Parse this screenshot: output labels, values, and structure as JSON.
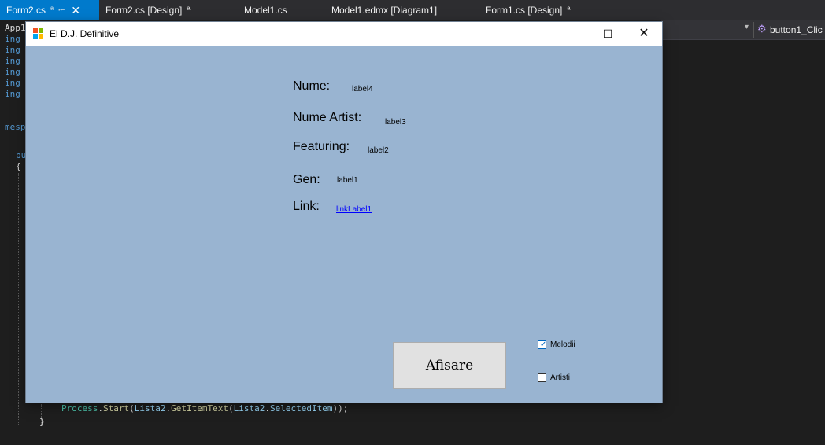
{
  "ide": {
    "tabs": [
      {
        "label": "Form2.cs",
        "pin": "฿",
        "lock": "ª",
        "active": true
      },
      {
        "label": "Form2.cs [Design]",
        "suffix": "ª"
      },
      {
        "label": "Model1.cs"
      },
      {
        "label": "Model1.edmx [Diagram1]"
      },
      {
        "label": "Form1.cs [Design]",
        "suffix": "ª"
      }
    ],
    "tab_glyphs": {
      "lock": "ª",
      "pin": "⭰",
      "close": "✕"
    },
    "nav": {
      "method_label": "button1_Clic"
    },
    "gutter_lines": [
      "App1",
      "ing",
      "ing",
      "ing",
      "ing",
      "ing",
      "ing",
      "",
      "mesp",
      "",
      "pu",
      "{"
    ],
    "code_line": {
      "a": "Process",
      "b": ".",
      "c": "Start",
      "d": "(",
      "e": "Lista2",
      "f": ".",
      "g": "GetItemText",
      "h": "(",
      "i": "Lista2",
      "j": ".",
      "k": "SelectedItem",
      "l": "));"
    },
    "closing_brace": "}"
  },
  "form": {
    "title": "El D.J. Definitive",
    "labels": {
      "nume": "Nume:",
      "nume_value": "label4",
      "nume_artist": "Nume Artist:",
      "nume_artist_value": "label3",
      "featuring": "Featuring:",
      "featuring_value": "label2",
      "gen": "Gen:",
      "gen_value": "label1",
      "link": "Link:",
      "link_value": "linkLabel1"
    },
    "button_label": "Afisare",
    "checkboxes": [
      {
        "label": "Melodii",
        "checked": true
      },
      {
        "label": "Artisti",
        "checked": false
      }
    ],
    "colors": {
      "client": "#99b4d1",
      "link": "#0000ff",
      "ide_bg": "#1e1e1e",
      "tab_active": "#007acc"
    }
  }
}
